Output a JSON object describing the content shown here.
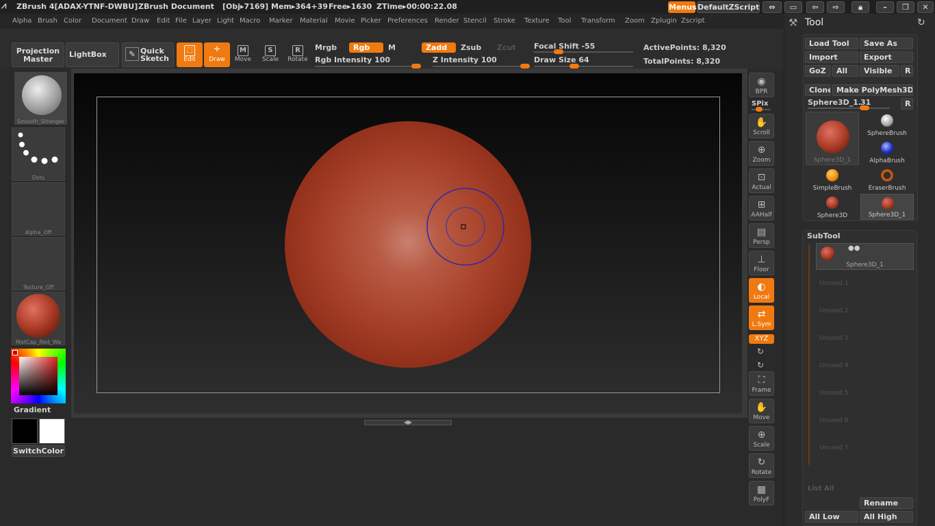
{
  "titlebar": {
    "app": "ZBrush 4[ADAX-YTNF-DWBU]",
    "document": "ZBrush Document",
    "obj": "[Obj▸7169]",
    "mem": "Mem▸364+39",
    "free": "Free▸1630",
    "ztime": "ZTime▸00:00:22.08",
    "menus_label": "Menus",
    "script_label": "DefaultZScript"
  },
  "menubar": [
    "Alpha",
    "Brush",
    "Color",
    "Document",
    "Draw",
    "Edit",
    "File",
    "Layer",
    "Light",
    "Macro",
    "Marker",
    "Material",
    "Movie",
    "Picker",
    "Preferences",
    "Render",
    "Stencil",
    "Stroke",
    "Texture",
    "Tool",
    "Transform",
    "Zoom",
    "Zplugin",
    "Zscript"
  ],
  "toolbar": {
    "projection_master": "Projection\nMaster",
    "lightbox": "LightBox",
    "quick_sketch": "Quick\nSketch",
    "edit": "Edit",
    "draw": "Draw",
    "move": "Move",
    "scale": "Scale",
    "rotate": "Rotate",
    "mrgb": "Mrgb",
    "rgb": "Rgb",
    "m": "M",
    "zadd": "Zadd",
    "zsub": "Zsub",
    "zcut": "Zcut",
    "rgb_intensity": "Rgb Intensity 100",
    "z_intensity": "Z Intensity 100",
    "focal_shift": "Focal Shift -55",
    "draw_size": "Draw Size 64",
    "active_points": "ActivePoints: 8,320",
    "total_points": "TotalPoints: 8,320"
  },
  "sliders": {
    "rgb_intensity": 100,
    "z_intensity": 100,
    "focal_shift": -55,
    "draw_size": 64
  },
  "leftshelf": {
    "brush": "Smooth_Stronger",
    "stroke": "Dots",
    "alpha": "Alpha_Off",
    "texture": "Texture_Off",
    "material": "MatCap_Red_Wa",
    "gradient": "Gradient",
    "switchcolor": "SwitchColor"
  },
  "rightshelf": [
    "BPR",
    "SPix",
    "Scroll",
    "Zoom",
    "Actual",
    "AAHalf",
    "Persp",
    "Floor",
    "Local",
    "L.Sym",
    "XYZ",
    "Frame",
    "Move",
    "Scale",
    "Rotate",
    "PolyF"
  ],
  "tool": {
    "title": "Tool",
    "load_tool": "Load Tool",
    "save_as": "Save As",
    "import": "Import",
    "export": "Export",
    "goz": "GoZ",
    "all": "All",
    "visible": "Visible",
    "r": "R",
    "clone": "Clone",
    "make_polymesh": "Make PolyMesh3D",
    "current_tool": "Sphere3D_1.",
    "current_tool_num": "31",
    "brushes": [
      {
        "name": "Sphere3D_1",
        "kind": "sphere"
      },
      {
        "name": "SphereBrush",
        "kind": "grey"
      },
      {
        "name": "AlphaBrush",
        "kind": "blue"
      },
      {
        "name": "SimpleBrush",
        "kind": "s"
      },
      {
        "name": "EraserBrush",
        "kind": "eraser"
      },
      {
        "name": "Sphere3D",
        "kind": "sphere"
      },
      {
        "name": "Sphere3D_1",
        "kind": "sphere"
      }
    ]
  },
  "subtool": {
    "title": "SubTool",
    "active": "Sphere3D_1",
    "slots": [
      "Unused 1",
      "Unused 2",
      "Unused 3",
      "Unused 4",
      "Unused 5",
      "Unused 6",
      "Unused 7"
    ],
    "list_all": "List All",
    "rename": "Rename",
    "all_low": "All Low",
    "all_high": "All High"
  },
  "colors": {
    "accent": "#f07a10",
    "sphere": "#a83a24",
    "brush_ring": "#2a2aa8"
  }
}
